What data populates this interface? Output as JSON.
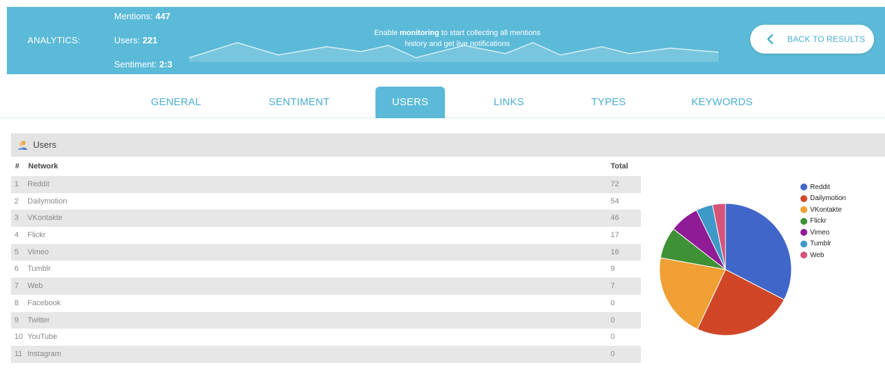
{
  "header": {
    "analytics_label": "ANALYTICS:",
    "mentions_label": "Mentions:",
    "mentions_value": "447",
    "users_label": "Users:",
    "users_value": "221",
    "sentiment_label": "Sentiment:",
    "sentiment_value": "2:3",
    "monitor_pre": "Enable",
    "monitor_bold": "monitoring",
    "monitor_post": "to start collecting all mentions history and get live notifications",
    "back_label": "BACK TO RESULTS",
    "accent_color": "#5bbad7"
  },
  "tabs": [
    {
      "label": "GENERAL"
    },
    {
      "label": "SENTIMENT"
    },
    {
      "label": "USERS",
      "active": true
    },
    {
      "label": "LINKS"
    },
    {
      "label": "TYPES"
    },
    {
      "label": "KEYWORDS"
    }
  ],
  "panel": {
    "title": "Users",
    "icon": "users-icon",
    "columns": {
      "hash": "#",
      "network": "Network",
      "total": "Total"
    },
    "rows": [
      {
        "num": "1",
        "network": "Reddit",
        "total": "72"
      },
      {
        "num": "2",
        "network": "Dailymotion",
        "total": "54"
      },
      {
        "num": "3",
        "network": "VKontakte",
        "total": "46"
      },
      {
        "num": "4",
        "network": "Flickr",
        "total": "17"
      },
      {
        "num": "5",
        "network": "Vimeo",
        "total": "16"
      },
      {
        "num": "6",
        "network": "Tumblr",
        "total": "9"
      },
      {
        "num": "7",
        "network": "Web",
        "total": "7"
      },
      {
        "num": "8",
        "network": "Facebook",
        "total": "0"
      },
      {
        "num": "9",
        "network": "Twitter",
        "total": "0"
      },
      {
        "num": "10",
        "network": "YouTube",
        "total": "0"
      },
      {
        "num": "11",
        "network": "Instagram",
        "total": "0"
      }
    ]
  },
  "chart_data": {
    "type": "pie",
    "categories": [
      "Reddit",
      "Dailymotion",
      "VKontakte",
      "Flickr",
      "Vimeo",
      "Tumblr",
      "Web"
    ],
    "values": [
      72,
      54,
      46,
      17,
      16,
      9,
      7
    ],
    "colors": [
      "#3f66c8",
      "#d04627",
      "#f0a035",
      "#3f9136",
      "#8f1b96",
      "#3d99c7",
      "#d6537a"
    ],
    "legend_position": "right"
  }
}
